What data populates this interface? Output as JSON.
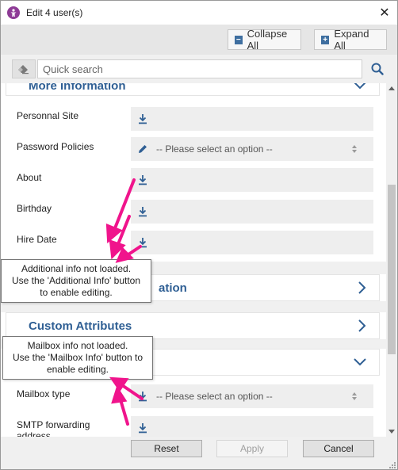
{
  "window": {
    "title": "Edit 4 user(s)"
  },
  "toolbar": {
    "collapse_label": "Collapse All",
    "expand_label": "Expand All"
  },
  "search": {
    "placeholder": "Quick search"
  },
  "sections": {
    "more_information": {
      "title": "More Information",
      "rows": [
        {
          "label": "Personnal Site"
        },
        {
          "label": "Password Policies",
          "value": "-- Please select an option --"
        },
        {
          "label": "About"
        },
        {
          "label": "Birthday"
        },
        {
          "label": "Hire Date"
        }
      ]
    },
    "partial_section_suffix": "ation",
    "custom_attributes": {
      "title": "Custom Attributes"
    },
    "mailbox": {
      "rows": [
        {
          "label": "Mailbox type",
          "value": "-- Please select an option --"
        },
        {
          "label": "SMTP forwarding address"
        }
      ]
    }
  },
  "tooltips": {
    "additional": {
      "lines": [
        "Additional info not loaded.",
        "Use the 'Additional Info' button",
        "to enable editing."
      ]
    },
    "mailbox": {
      "lines": [
        "Mailbox info not loaded.",
        "Use the 'Mailbox Info' button to",
        "enable editing."
      ]
    }
  },
  "footer": {
    "reset_label": "Reset",
    "apply_label": "Apply",
    "cancel_label": "Cancel"
  },
  "colors": {
    "accent_blue": "#2f5f94",
    "icon_blue": "#3f6fa0",
    "annotation_pink": "#f0148c",
    "app_icon": "#8e3b96"
  },
  "icons": [
    "app-logo-icon",
    "close-icon",
    "collapse-icon",
    "expand-icon",
    "eraser-icon",
    "search-icon",
    "download-icon",
    "pencil-icon",
    "sort-icon",
    "chevron-down-icon",
    "chevron-right-icon"
  ]
}
